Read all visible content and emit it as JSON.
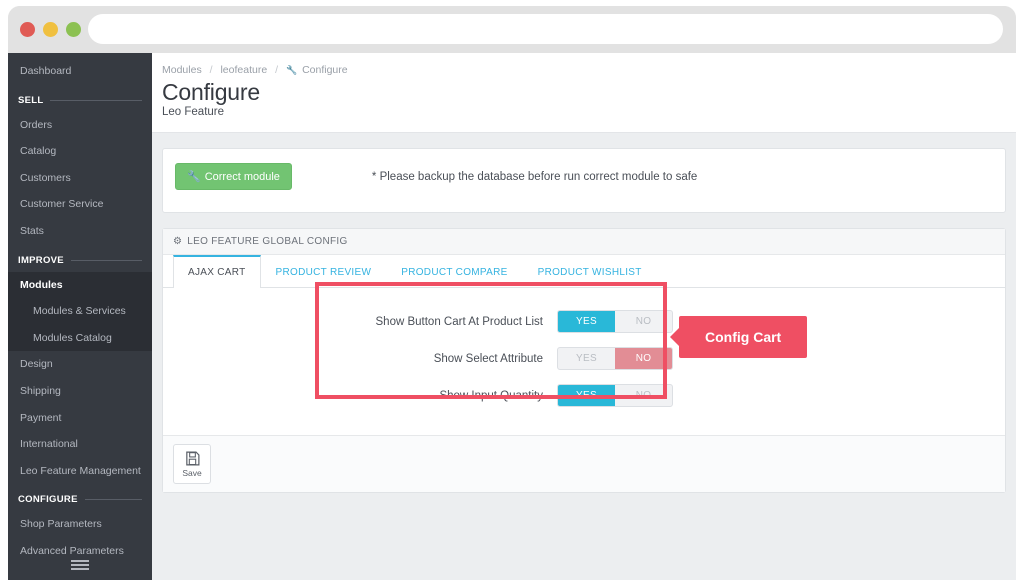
{
  "browser": {
    "url_value": "",
    "url_placeholder": "",
    "traffic_lights": [
      "close-red",
      "minimize-yellow",
      "maximize-green"
    ]
  },
  "sidebar": {
    "dashboard": "Dashboard",
    "sections": [
      {
        "label": "SELL",
        "items": [
          "Orders",
          "Catalog",
          "Customers",
          "Customer Service",
          "Stats"
        ]
      },
      {
        "label": "IMPROVE",
        "items": [
          "Design",
          "Shipping",
          "Payment",
          "International",
          "Leo Feature Management"
        ]
      },
      {
        "label": "CONFIGURE",
        "items": [
          "Shop Parameters",
          "Advanced Parameters"
        ]
      }
    ],
    "modules_group": {
      "parent": "Modules",
      "children": [
        "Modules & Services",
        "Modules Catalog"
      ]
    },
    "toggle_icon": "hamburger-icon"
  },
  "header": {
    "breadcrumb": [
      {
        "label": "Modules",
        "icon": ""
      },
      {
        "label": "leofeature",
        "icon": ""
      },
      {
        "label": "Configure",
        "icon": "wrench-icon"
      }
    ],
    "title": "Configure",
    "subtitle": "Leo Feature"
  },
  "correct_module_panel": {
    "button_label": "Correct module",
    "button_icon": "wrench-icon",
    "button_color": "#72c472",
    "note": "* Please backup the database before run correct module to safe"
  },
  "config_panel": {
    "header_label": "LEO FEATURE GLOBAL CONFIG",
    "header_icon": "cogs-icon",
    "tabs": [
      {
        "label": "AJAX CART",
        "active": true
      },
      {
        "label": "PRODUCT REVIEW",
        "active": false
      },
      {
        "label": "PRODUCT COMPARE",
        "active": false
      },
      {
        "label": "PRODUCT WISHLIST",
        "active": false
      }
    ],
    "accent_color": "#35b3e0",
    "rows": [
      {
        "label": "Show Button Cart At Product List",
        "yes": "YES",
        "no": "NO",
        "value": "YES"
      },
      {
        "label": "Show Select Attribute",
        "yes": "YES",
        "no": "NO",
        "value": "NO"
      },
      {
        "label": "Show Input Quantity",
        "yes": "YES",
        "no": "NO",
        "value": "YES"
      }
    ],
    "save_label": "Save",
    "save_icon": "floppy-disk-icon"
  },
  "annotation": {
    "callout_text": "Config Cart",
    "highlight_color": "#ef4f63"
  }
}
